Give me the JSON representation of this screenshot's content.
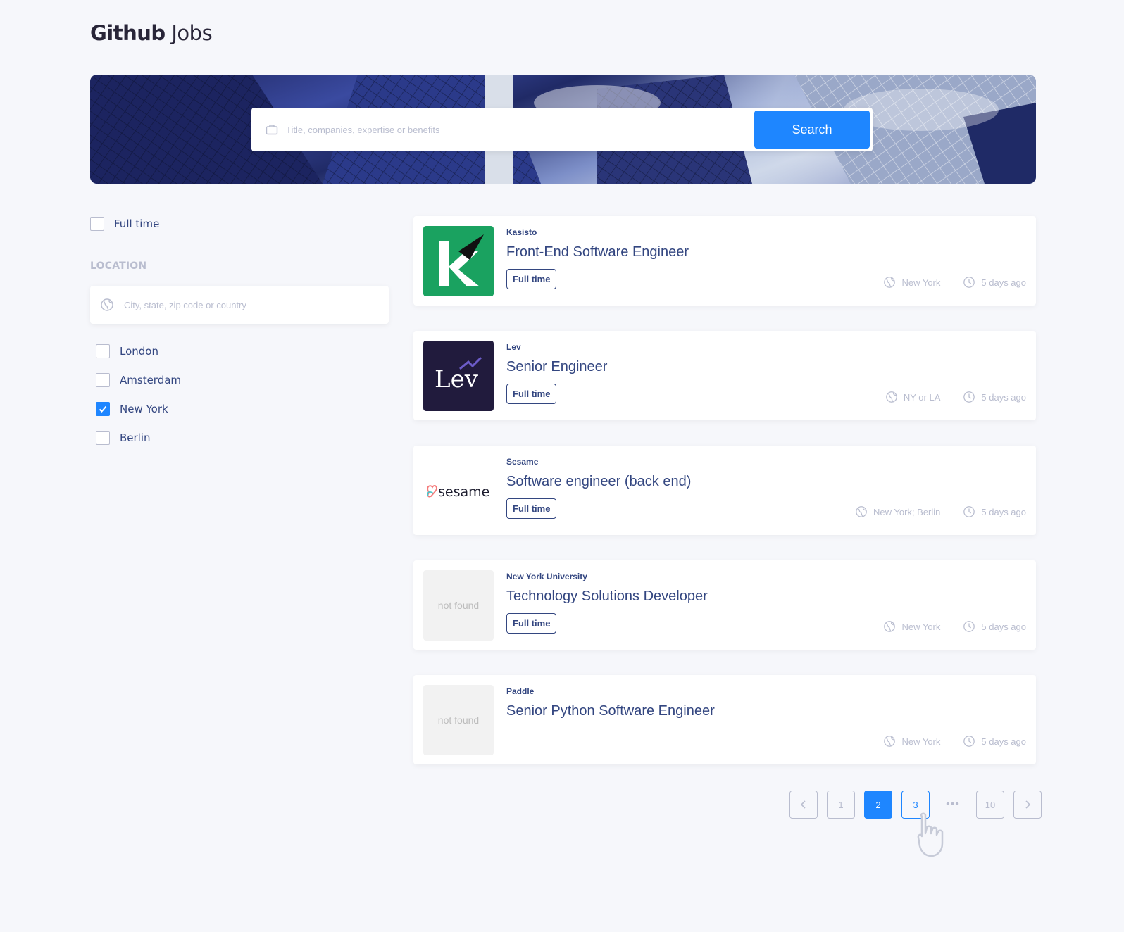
{
  "header": {
    "title_bold": "Github",
    "title_light": "Jobs"
  },
  "search": {
    "placeholder": "Title, companies, expertise or benefits",
    "button_label": "Search"
  },
  "filters": {
    "full_time_label": "Full time",
    "full_time_checked": false,
    "location_heading": "LOCATION",
    "location_placeholder": "City, state, zip code or country",
    "locations": [
      {
        "label": "London",
        "checked": false
      },
      {
        "label": "Amsterdam",
        "checked": false
      },
      {
        "label": "New York",
        "checked": true
      },
      {
        "label": "Berlin",
        "checked": false
      }
    ]
  },
  "jobs": [
    {
      "company": "Kasisto",
      "title": "Front-End Software Engineer",
      "tag": "Full time",
      "location": "New York",
      "posted": "5 days ago",
      "logo": "kasisto"
    },
    {
      "company": "Lev",
      "title": "Senior Engineer",
      "tag": "Full time",
      "location": "NY or LA",
      "posted": "5 days ago",
      "logo": "lev",
      "logo_text": "Lev"
    },
    {
      "company": "Sesame",
      "title": "Software engineer (back end)",
      "tag": "Full time",
      "location": "New York; Berlin",
      "posted": "5 days ago",
      "logo": "sesame",
      "logo_text": "sesame"
    },
    {
      "company": "New York University",
      "title": "Technology Solutions Developer",
      "tag": "Full time",
      "location": "New York",
      "posted": "5 days ago",
      "logo": "placeholder",
      "logo_text": "not found"
    },
    {
      "company": "Paddle",
      "title": "Senior Python Software Engineer",
      "tag": "",
      "location": "New York",
      "posted": "5 days ago",
      "logo": "placeholder",
      "logo_text": "not found"
    }
  ],
  "pagination": {
    "pages": [
      "1",
      "2",
      "3"
    ],
    "ellipsis": "•••",
    "last_page": "10",
    "current": "2",
    "hovered": "3"
  },
  "colors": {
    "primary": "#1e86ff",
    "text": "#334680",
    "muted": "#b9bdcf",
    "background": "#f6f7fb",
    "kasisto_green": "#1aa260",
    "lev_navy": "#211b3d"
  }
}
